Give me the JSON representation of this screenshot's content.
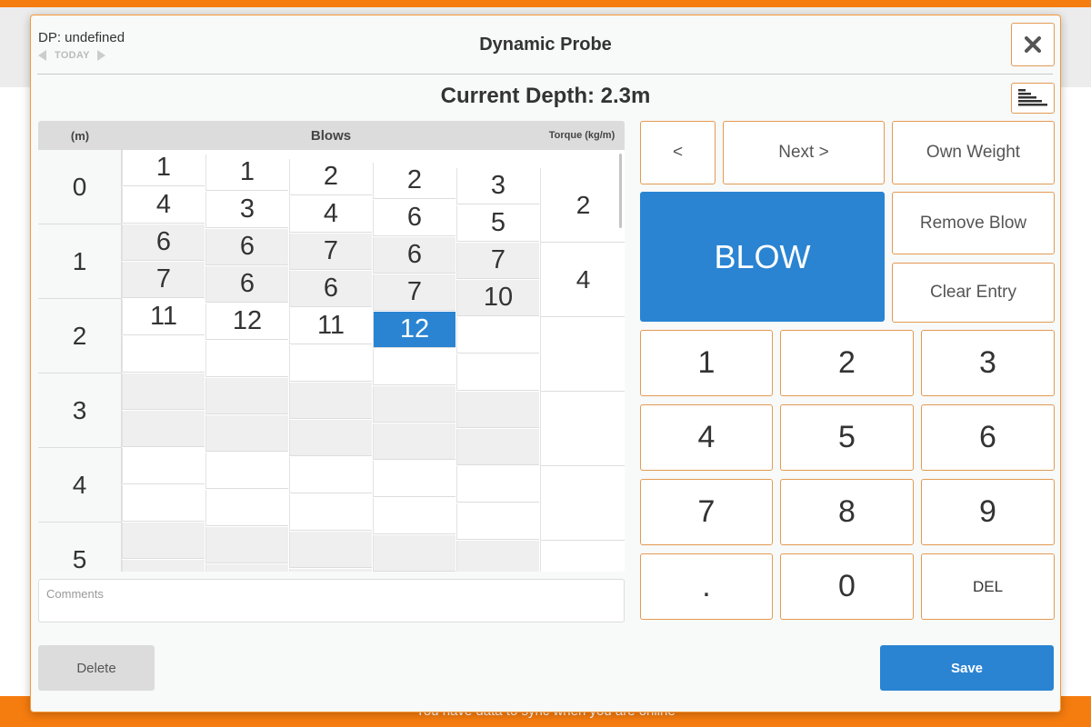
{
  "background": {
    "sync_message": "You have data to sync when you are online"
  },
  "header": {
    "dp_label": "DP: undefined",
    "date_label": "TODAY",
    "title": "Dynamic Probe",
    "close_icon": "close-icon",
    "graph_icon": "bar-graph-icon"
  },
  "current_depth": "Current Depth: 2.3m",
  "table": {
    "headers": {
      "depth": "(m)",
      "blows": "Blows",
      "torque": "Torque (kg/m)"
    },
    "depths": [
      "0",
      "1",
      "2",
      "3",
      "4",
      "5"
    ],
    "blow_columns": [
      [
        "1",
        "4",
        "6",
        "7",
        "11",
        "",
        "",
        "",
        "",
        "",
        "",
        ""
      ],
      [
        "1",
        "3",
        "6",
        "6",
        "12",
        "",
        "",
        "",
        "",
        "",
        "",
        ""
      ],
      [
        "2",
        "4",
        "7",
        "6",
        "11",
        "",
        "",
        "",
        "",
        "",
        "",
        ""
      ],
      [
        "2",
        "6",
        "6",
        "7",
        "12",
        "",
        "",
        "",
        "",
        "",
        "",
        ""
      ],
      [
        "3",
        "5",
        "7",
        "10",
        "",
        "",
        "",
        "",
        "",
        "",
        "",
        ""
      ]
    ],
    "active_cell": {
      "column": 3,
      "row": 4
    },
    "torque": [
      "2",
      "4",
      "",
      "",
      "",
      ""
    ]
  },
  "comments": {
    "placeholder": "Comments",
    "value": ""
  },
  "controls": {
    "prev": "<",
    "next": "Next >",
    "own_weight": "Own Weight",
    "blow": "BLOW",
    "remove_blow": "Remove Blow",
    "clear_entry": "Clear Entry"
  },
  "keypad": [
    "1",
    "2",
    "3",
    "4",
    "5",
    "6",
    "7",
    "8",
    "9",
    ".",
    "0",
    "DEL"
  ],
  "footer": {
    "delete": "Delete",
    "save": "Save"
  },
  "colors": {
    "accent": "#f57c0f",
    "primary": "#2a84d2",
    "button_border": "#e39a52"
  }
}
